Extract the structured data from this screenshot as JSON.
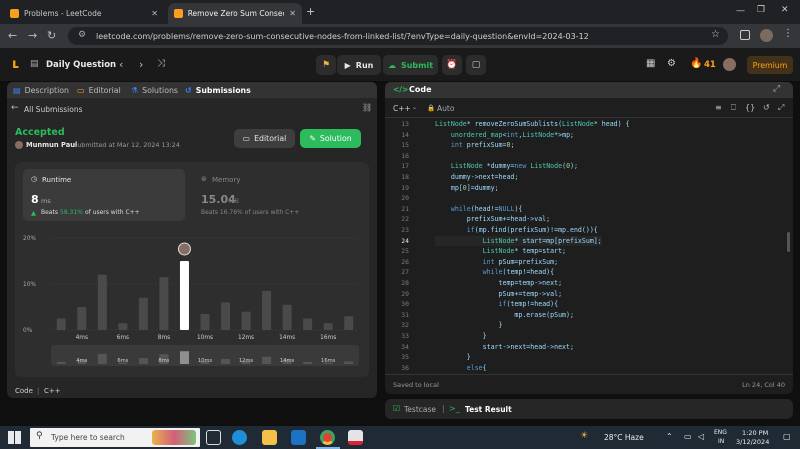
{
  "browser": {
    "tabs": [
      {
        "title": "Problems - LeetCode",
        "active": false
      },
      {
        "title": "Remove Zero Sum Consecutive",
        "active": true
      }
    ],
    "url": "leetcode.com/problems/remove-zero-sum-consecutive-nodes-from-linked-list/?envType=daily-question&envId=2024-03-12"
  },
  "topnav": {
    "title": "Daily Question",
    "run": "Run",
    "submit": "Submit",
    "streak": "41",
    "premium": "Premium"
  },
  "left_tabs": [
    "Description",
    "Editorial",
    "Solutions",
    "Submissions"
  ],
  "submission": {
    "back": "All Submissions",
    "status": "Accepted",
    "user": "Munmun Paul",
    "submitted": "submitted at Mar 12, 2024 13:24",
    "editorial_btn": "Editorial",
    "solution_btn": "Solution",
    "runtime_label": "Runtime",
    "runtime_value": "8",
    "runtime_unit": "ms",
    "runtime_beats_pre": "Beats",
    "runtime_beats_pct": "58.31%",
    "runtime_beats_post": "of users with C++",
    "memory_label": "Memory",
    "memory_value": "15.04",
    "memory_unit": "MB",
    "memory_beats": "Beats 16.76% of users with C++"
  },
  "chart_data": {
    "type": "bar",
    "ytick_labels": [
      "20%",
      "10%",
      "0%"
    ],
    "ylim": [
      0,
      20
    ],
    "x_tick_labels": [
      "4ms",
      "6ms",
      "8ms",
      "10ms",
      "12ms",
      "14ms",
      "16ms"
    ],
    "values": [
      2.5,
      5,
      12,
      1.5,
      7,
      11.5,
      15,
      3.5,
      6,
      4,
      8.5,
      5.5,
      2.5,
      1.5,
      3
    ],
    "highlight_index": 6
  },
  "code_footer": {
    "code_label": "Code",
    "lang": "C++",
    "snippet": "/**"
  },
  "editor": {
    "tab": "Code",
    "lang": "C++",
    "mode": "Auto",
    "status_left": "Saved to local",
    "status_right": "Ln 24, Col 40",
    "start_line": 13,
    "lines": [
      "ListNode* removeZeroSumSublists(ListNode* head) {",
      "    unordered_map<int,ListNode*>mp;",
      "    int prefixSum=0;",
      "",
      "    ListNode *dummy=new ListNode(0);",
      "    dummy->next=head;",
      "    mp[0]=dummy;",
      "",
      "    while(head!=NULL){",
      "        prefixSum+=head->val;",
      "        if(mp.find(prefixSum)!=mp.end()){",
      "            ListNode* start=mp[prefixSum];",
      "            ListNode* temp=start;",
      "            int pSum=prefixSum;",
      "            while(temp!=head){",
      "                temp=temp->next;",
      "                pSum+=temp->val;",
      "                if(temp!=head){",
      "                    mp.erase(pSum);",
      "                }",
      "            }",
      "            start->next=head->next;",
      "        }",
      "        else{"
    ]
  },
  "bottom": {
    "testcase": "Testcase",
    "result": "Test Result"
  },
  "taskbar": {
    "search": "Type here to search",
    "weather": "28°C  Haze",
    "lang1": "ENG",
    "lang2": "IN",
    "time": "1:20 PM",
    "date": "3/12/2024"
  },
  "colors": {
    "accent_green": "#2cbb5d",
    "orange": "#ffa116",
    "blue": "#3b82f6"
  }
}
